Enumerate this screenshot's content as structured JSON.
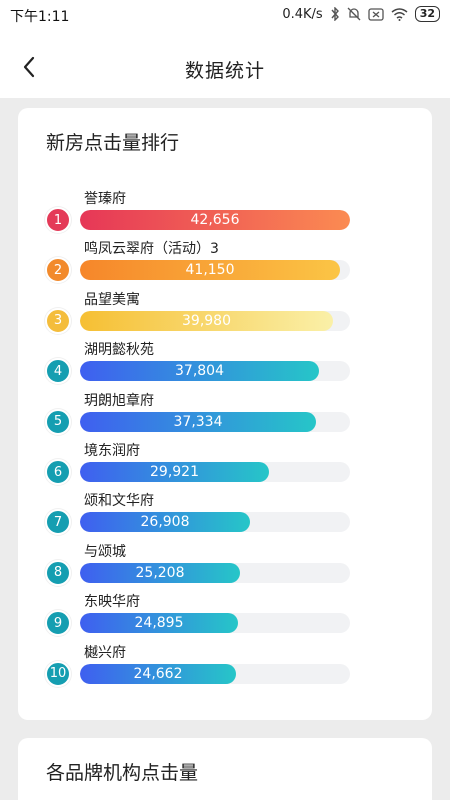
{
  "status": {
    "time": "下午1:11",
    "network_speed": "0.4K/s",
    "battery": "32"
  },
  "nav": {
    "title": "数据统计"
  },
  "ranking": {
    "title": "新房点击量排行",
    "max_value": 42656,
    "items": [
      {
        "rank": "1",
        "name": "誉瑧府",
        "value": 42656,
        "value_label": "42,656",
        "style": "red"
      },
      {
        "rank": "2",
        "name": "鸣凤云翠府（活动）3",
        "value": 41150,
        "value_label": "41,150",
        "style": "orange"
      },
      {
        "rank": "3",
        "name": "品望美寓",
        "value": 39980,
        "value_label": "39,980",
        "style": "yellow"
      },
      {
        "rank": "4",
        "name": "湖明懿秋苑",
        "value": 37804,
        "value_label": "37,804",
        "style": "blue"
      },
      {
        "rank": "5",
        "name": "玥朗旭章府",
        "value": 37334,
        "value_label": "37,334",
        "style": "blue"
      },
      {
        "rank": "6",
        "name": "境东润府",
        "value": 29921,
        "value_label": "29,921",
        "style": "blue"
      },
      {
        "rank": "7",
        "name": "颂和文华府",
        "value": 26908,
        "value_label": "26,908",
        "style": "blue"
      },
      {
        "rank": "8",
        "name": "与颂城",
        "value": 25208,
        "value_label": "25,208",
        "style": "blue"
      },
      {
        "rank": "9",
        "name": "东映华府",
        "value": 24895,
        "value_label": "24,895",
        "style": "blue"
      },
      {
        "rank": "10",
        "name": "樾兴府",
        "value": 24662,
        "value_label": "24,662",
        "style": "blue"
      }
    ]
  },
  "brand": {
    "title": "各品牌机构点击量"
  },
  "colors": {
    "red_badge": "#e43a58",
    "red_gradient": [
      "#e63757",
      "#fb8b52"
    ],
    "orange_badge": "#f28a2c",
    "orange_gradient": [
      "#f6862a",
      "#fbc545"
    ],
    "yellow_badge": "#f4bd3c",
    "yellow_gradient": [
      "#f6bf33",
      "#faf0a8"
    ],
    "teal_badge": "#159eb1",
    "blue_gradient": [
      "#3f5ff0",
      "#26c6c8"
    ]
  }
}
